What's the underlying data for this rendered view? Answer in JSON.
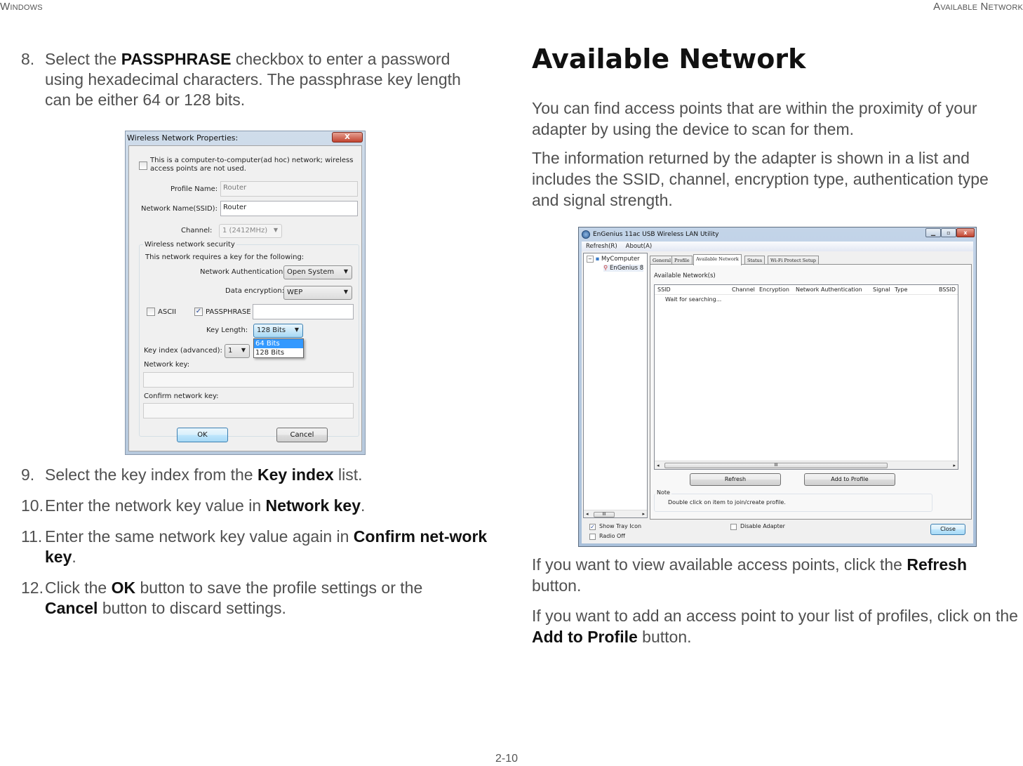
{
  "header": {
    "left": "Windows",
    "right": "Available Network"
  },
  "footer": {
    "page": "2-10"
  },
  "left_column": {
    "steps": [
      {
        "num": "8.",
        "parts": [
          "Select the ",
          "PASSPHRASE",
          " checkbox to enter a password using hexadecimal characters. The passphrase key length can be either 64 or 128 bits."
        ]
      },
      {
        "num": "9.",
        "parts": [
          "Select the key index from the ",
          "Key index",
          " list."
        ]
      },
      {
        "num": "10.",
        "parts": [
          "Enter the network key value in ",
          "Network key",
          "."
        ]
      },
      {
        "num": "11.",
        "parts": [
          "Enter the same network key value again in ",
          "Confirm net-work key",
          "."
        ]
      },
      {
        "num": "12.",
        "parts": [
          "Click the ",
          "OK",
          " button to save the profile settings or the ",
          "Cancel",
          " button to discard settings."
        ]
      }
    ]
  },
  "wireless_dialog": {
    "title": "Wireless Network Properties:",
    "close": "X",
    "adhoc_label": "This is a computer-to-computer(ad hoc) network; wireless access points are not used.",
    "adhoc_checked": false,
    "profile_name_label": "Profile Name:",
    "profile_name_value": "Router",
    "ssid_label": "Network Name(SSID):",
    "ssid_value": "Router",
    "channel_label": "Channel:",
    "channel_value": "1  (2412MHz)",
    "security_group": "Wireless network security",
    "requires_key": "This network requires a key for the following:",
    "auth_label": "Network Authentication:",
    "auth_value": "Open System",
    "enc_label": "Data encryption:",
    "enc_value": "WEP",
    "ascii_label": "ASCII",
    "ascii_checked": false,
    "passphrase_label": "PASSPHRASE",
    "passphrase_checked": true,
    "passphrase_value": "",
    "key_length_label": "Key Length:",
    "key_length_value": "128 Bits",
    "key_length_options": [
      "64 Bits",
      "128 Bits"
    ],
    "key_index_label": "Key index (advanced):",
    "key_index_value": "1",
    "network_key_label": "Network key:",
    "network_key_value": "",
    "confirm_key_label": "Confirm network key:",
    "confirm_key_value": "",
    "ok": "OK",
    "cancel": "Cancel"
  },
  "right_column": {
    "title": "Available Network",
    "para1": "You can find access points that are within the proximity of your adapter by using the device to scan for them.",
    "para2": "The information returned by the adapter is shown in a list and includes the SSID, channel, encryption type, authentication type and signal strength.",
    "para3": [
      "If you want to view available access points, click the ",
      "Refresh",
      " button."
    ],
    "para4": [
      "If you want to add an access point to your list of profiles, click on the ",
      "Add to Profile",
      " button."
    ]
  },
  "utility_window": {
    "title": "EnGenius 11ac USB Wireless LAN Utility",
    "menu": [
      "Refresh(R)",
      "About(A)"
    ],
    "tree": {
      "root": "MyComputer",
      "child": "EnGenius 8"
    },
    "tabs": [
      "General",
      "Profile",
      "Available Network",
      "Status",
      "Wi-Fi Protect Setup"
    ],
    "active_tab": "Available Network",
    "section_label": "Available Network(s)",
    "columns": [
      "SSID",
      "Channel",
      "Encryption",
      "Network Authentication",
      "Signal",
      "Type",
      "BSSID"
    ],
    "status_row": "Wait for searching...",
    "refresh": "Refresh",
    "add_to_profile": "Add to Profile",
    "note_label": "Note",
    "note_text": "Double click on item to join/create profile.",
    "show_tray_icon": "Show Tray Icon",
    "show_tray_checked": true,
    "radio_off": "Radio Off",
    "radio_off_checked": false,
    "disable_adapter": "Disable Adapter",
    "disable_adapter_checked": false,
    "close": "Close"
  }
}
